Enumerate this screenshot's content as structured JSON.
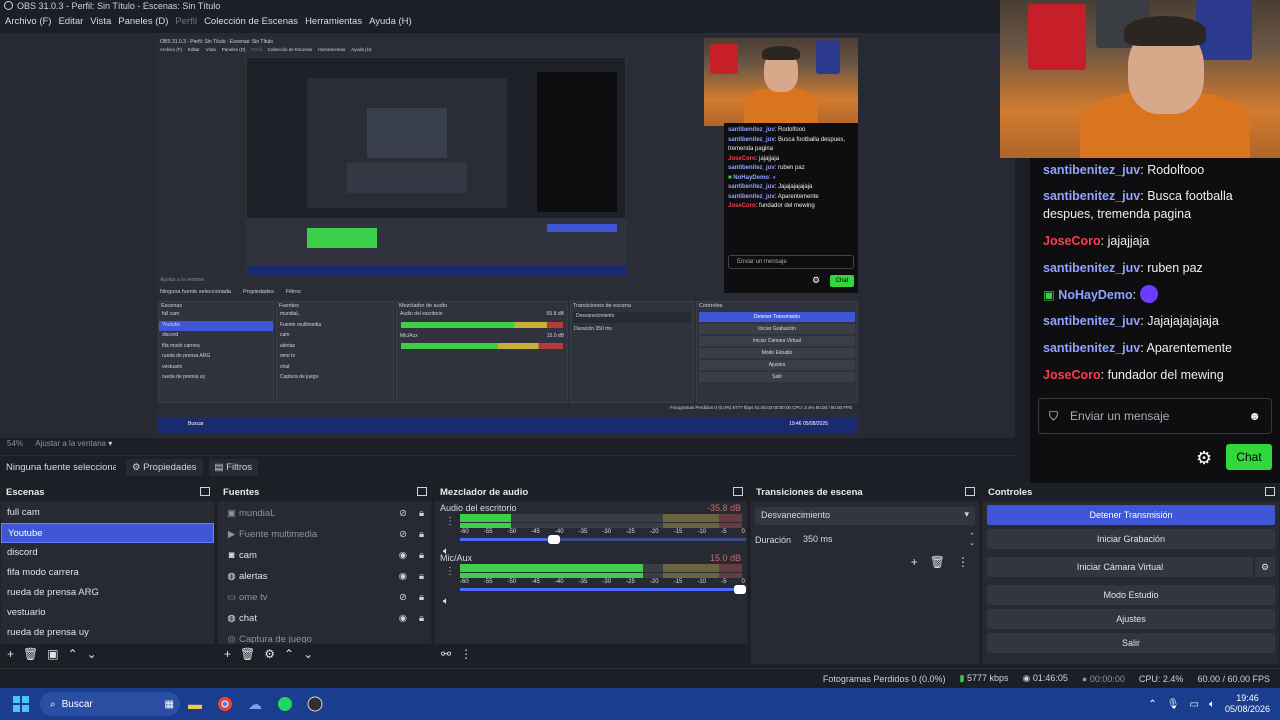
{
  "window": {
    "title": "OBS 31.0.3 - Perfil: Sin Título - Escenas: Sin Título"
  },
  "menu": [
    "Archivo (F)",
    "Editar",
    "Vista",
    "Paneles (D)",
    "Perfil",
    "Colección de Escenas",
    "Herramientas",
    "Ayuda (H)"
  ],
  "preview": {
    "zoom": "54%",
    "fit_label": "Ajustar a la ventana"
  },
  "nested": {
    "title": "OBS 31.0.3 - Perfil: Sin Título - Escenas: Sin Título",
    "menu": [
      "Archivo (F)",
      "Editar",
      "Vista",
      "Paneles (D)",
      "Perfil",
      "Colección de Escenas",
      "Herramientas",
      "Ayuda (H)"
    ],
    "no_source": "Ninguna fuente seleccionada",
    "props": "Propiedades",
    "filters": "Filtros",
    "zoom": "Ajustar a la ventana",
    "scenes": [
      "full cam",
      "Youtube",
      "discord",
      "fifa modo carrera",
      "rueda de prensa ARG",
      "vestuario",
      "rueda de prensa uy"
    ],
    "sources": [
      "mundiaL",
      "Fuente multimedia",
      "cam",
      "alertas",
      "ome tv",
      "chat",
      "Captura de juego"
    ],
    "transition": "Desvanecimiento",
    "duration_label": "Duración",
    "duration": "350 ms",
    "buttons": [
      "Detener Transmisión",
      "Iniciar Grabación",
      "Iniciar Cámara Virtual",
      "Modo Estudio",
      "Ajustes",
      "Salir"
    ],
    "mixer": {
      "desktop": "Audio del escritorio",
      "desktop_db": "-55.8 dB",
      "mic": "Mic/Aux",
      "mic_db": "15.0 dB"
    },
    "status": "Fotogramas Perdidos 0 (0.0%)   5777 kbps   01:46:03   00:00:00   CPU: 2.4%   60.00 / 60.00 FPS",
    "search": "Buscar",
    "time": "19:46",
    "date": "05/08/2026",
    "docks": {
      "scenes": "Escenas",
      "sources": "Fuentes",
      "mixer": "Mezclador de audio",
      "transitions": "Transiciones de escena",
      "controls": "Controles"
    },
    "chat": [
      {
        "user": "santibenitez_juv",
        "msg": "Rodolfooo"
      },
      {
        "user": "santibenitez_juv",
        "msg": "Busca footballa despues, tremenda pagina"
      },
      {
        "user": "JoseCoro",
        "msg": "jajajjaja"
      },
      {
        "user": "santibenitez_juv",
        "msg": "ruben paz"
      },
      {
        "user": "NoHayDemo",
        "msg": ""
      },
      {
        "user": "santibenitez_juv",
        "msg": "Jajajajajajaja"
      },
      {
        "user": "santibenitez_juv",
        "msg": "Aparentemente"
      },
      {
        "user": "JoseCoro",
        "msg": "fundador del mewing"
      }
    ],
    "chat_input": "Enviar un mensaje",
    "chat_btn": "Chat"
  },
  "chat_overlay": {
    "messages": [
      {
        "user": "santibenitez_juv",
        "msg": "Rodolfooo",
        "color": "#8fa3ff"
      },
      {
        "user": "santibenitez_juv",
        "msg": "Busca footballa despues, tremenda pagina",
        "color": "#8fa3ff"
      },
      {
        "user": "JoseCoro",
        "msg": "jajajjaja",
        "color": "#ff3b4e"
      },
      {
        "user": "santibenitez_juv",
        "msg": "ruben paz",
        "color": "#8fa3ff"
      },
      {
        "user": "NoHayDemo",
        "msg": "",
        "color": "#8fa3ff"
      },
      {
        "user": "santibenitez_juv",
        "msg": "Jajajajajajaja",
        "color": "#8fa3ff"
      },
      {
        "user": "santibenitez_juv",
        "msg": "Aparentemente",
        "color": "#8fa3ff"
      },
      {
        "user": "JoseCoro",
        "msg": "fundador del mewing",
        "color": "#ff3b4e"
      }
    ],
    "input_placeholder": "Enviar un mensaje",
    "chat_button": "Chat"
  },
  "source_toolbar": {
    "none_selected": "Ninguna fuente seleccionada",
    "properties": "Propiedades",
    "filters": "Filtros"
  },
  "docks": {
    "scenes": {
      "title": "Escenas",
      "items": [
        "full cam",
        "Youtube",
        "discord",
        "fifa modo carrera",
        "rueda de prensa ARG",
        "vestuario",
        "rueda de prensa uy"
      ],
      "selected": "Youtube"
    },
    "sources": {
      "title": "Fuentes",
      "items": [
        {
          "name": "mundiaL",
          "icon": "image-icon",
          "visible": false
        },
        {
          "name": "Fuente multimedia",
          "icon": "play-icon",
          "visible": false
        },
        {
          "name": "cam",
          "icon": "camera-icon",
          "visible": true
        },
        {
          "name": "alertas",
          "icon": "globe-icon",
          "visible": true
        },
        {
          "name": "ome tv",
          "icon": "window-icon",
          "visible": false
        },
        {
          "name": "chat",
          "icon": "globe-icon",
          "visible": true
        },
        {
          "name": "Captura de juego",
          "icon": "gamepad-icon",
          "visible": false
        }
      ]
    },
    "mixer": {
      "title": "Mezclador de audio",
      "channels": [
        {
          "name": "Audio del escritorio",
          "db": "-35.8 dB",
          "level": 0.18,
          "volume": 0.33
        },
        {
          "name": "Mic/Aux",
          "db": "15.0 dB",
          "level": 0.65,
          "volume": 0.98
        }
      ],
      "ticks": [
        "-60",
        "-55",
        "-50",
        "-45",
        "-40",
        "-35",
        "-30",
        "-25",
        "-20",
        "-15",
        "-10",
        "-5",
        "0"
      ]
    },
    "transitions": {
      "title": "Transiciones de escena",
      "type": "Desvanecimiento",
      "duration_label": "Duración",
      "duration": "350 ms"
    },
    "controls": {
      "title": "Controles",
      "buttons": [
        "Detener Transmisión",
        "Iniciar Grabación",
        "Iniciar Cámara Virtual",
        "Modo Estudio",
        "Ajustes",
        "Salir"
      ]
    }
  },
  "status": {
    "dropped": "Fotogramas Perdidos 0 (0.0%)",
    "bitrate": "5777 kbps",
    "live_time": "01:46:05",
    "rec_time": "00:00:00",
    "cpu": "CPU: 2.4%",
    "fps": "60.00 / 60.00 FPS"
  },
  "taskbar": {
    "search": "Buscar",
    "time": "19:46",
    "date": "05/08/2026"
  }
}
